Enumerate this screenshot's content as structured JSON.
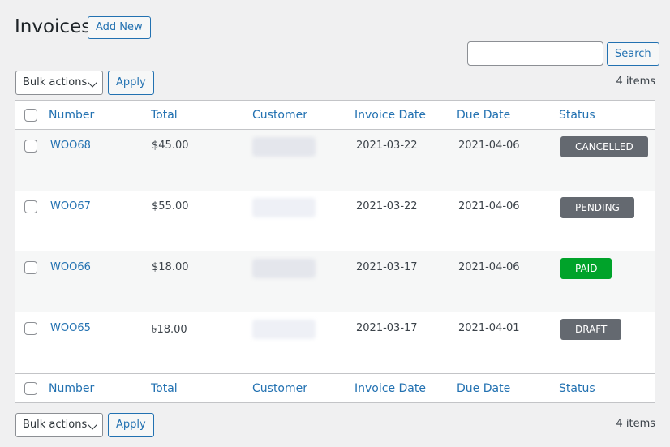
{
  "header": {
    "title": "Invoices",
    "add_new_label": "Add New"
  },
  "search": {
    "value": "",
    "button_label": "Search"
  },
  "bulk": {
    "label": "Bulk actions",
    "apply_label": "Apply"
  },
  "items_count": "4 items",
  "columns": [
    "Number",
    "Total",
    "Customer",
    "Invoice Date",
    "Due Date",
    "Status"
  ],
  "colors": {
    "accent": "#2271b1",
    "status_cancelled": "#646970",
    "status_pending": "#646970",
    "status_paid": "#00a32a",
    "status_draft": "#646970"
  },
  "rows": [
    {
      "number": "WOO68",
      "total": "$45.00",
      "invoice_date": "2021-03-22",
      "due_date": "2021-04-06",
      "status": "CANCELLED",
      "status_color": "#646970"
    },
    {
      "number": "WOO67",
      "total": "$55.00",
      "invoice_date": "2021-03-22",
      "due_date": "2021-04-06",
      "status": "PENDING",
      "status_color": "#646970"
    },
    {
      "number": "WOO66",
      "total": "$18.00",
      "invoice_date": "2021-03-17",
      "due_date": "2021-04-06",
      "status": "PAID",
      "status_color": "#00a32a"
    },
    {
      "number": "WOO65",
      "total": "৳18.00",
      "invoice_date": "2021-03-17",
      "due_date": "2021-04-01",
      "status": "DRAFT",
      "status_color": "#646970"
    }
  ]
}
